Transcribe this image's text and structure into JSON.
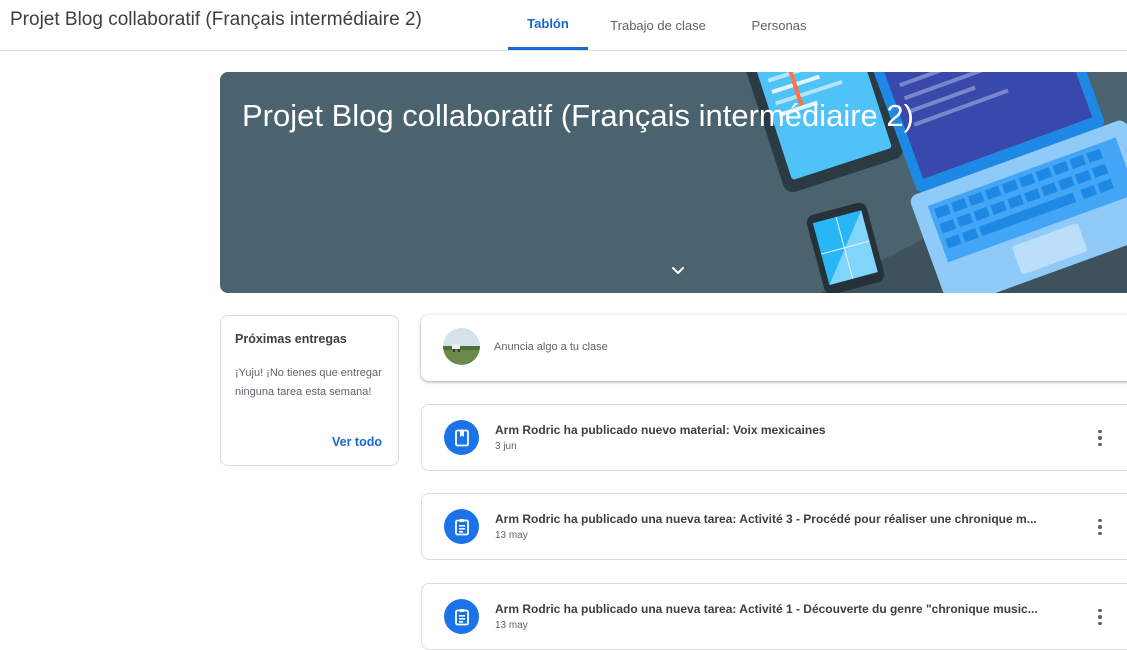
{
  "app": {
    "title": "Projet Blog collaboratif (Français intermédiaire 2)"
  },
  "tabs": [
    {
      "label": "Tablón",
      "active": true
    },
    {
      "label": "Trabajo de clase",
      "active": false
    },
    {
      "label": "Personas",
      "active": false
    }
  ],
  "banner": {
    "title": "Projet Blog collaboratif (Français intermédiaire 2)",
    "background_color": "#4b636f",
    "toggle_icon": "chevron-down-icon"
  },
  "upcoming": {
    "title": "Próximas entregas",
    "message": "¡Yuju! ¡No tienes que entregar ninguna tarea esta semana!",
    "view_all": "Ver todo"
  },
  "announce": {
    "placeholder": "Anuncia algo a tu clase"
  },
  "stream": [
    {
      "title": "Arm Rodric ha publicado nuevo material: Voix mexicaines",
      "date": "3 jun",
      "icon": "material-icon"
    },
    {
      "title": "Arm Rodric ha publicado una nueva tarea: Activité 3 - Procédé pour réaliser une chronique m...",
      "date": "13 may",
      "icon": "assignment-icon"
    },
    {
      "title": "Arm Rodric ha publicado una nueva tarea: Activité 1 - Découverte du genre \"chronique music...",
      "date": "13 may",
      "icon": "assignment-icon"
    }
  ],
  "colors": {
    "accent": "#1967d2",
    "icon_bg": "#1a73e8",
    "text": "#3c4043",
    "muted": "#5f6368"
  }
}
